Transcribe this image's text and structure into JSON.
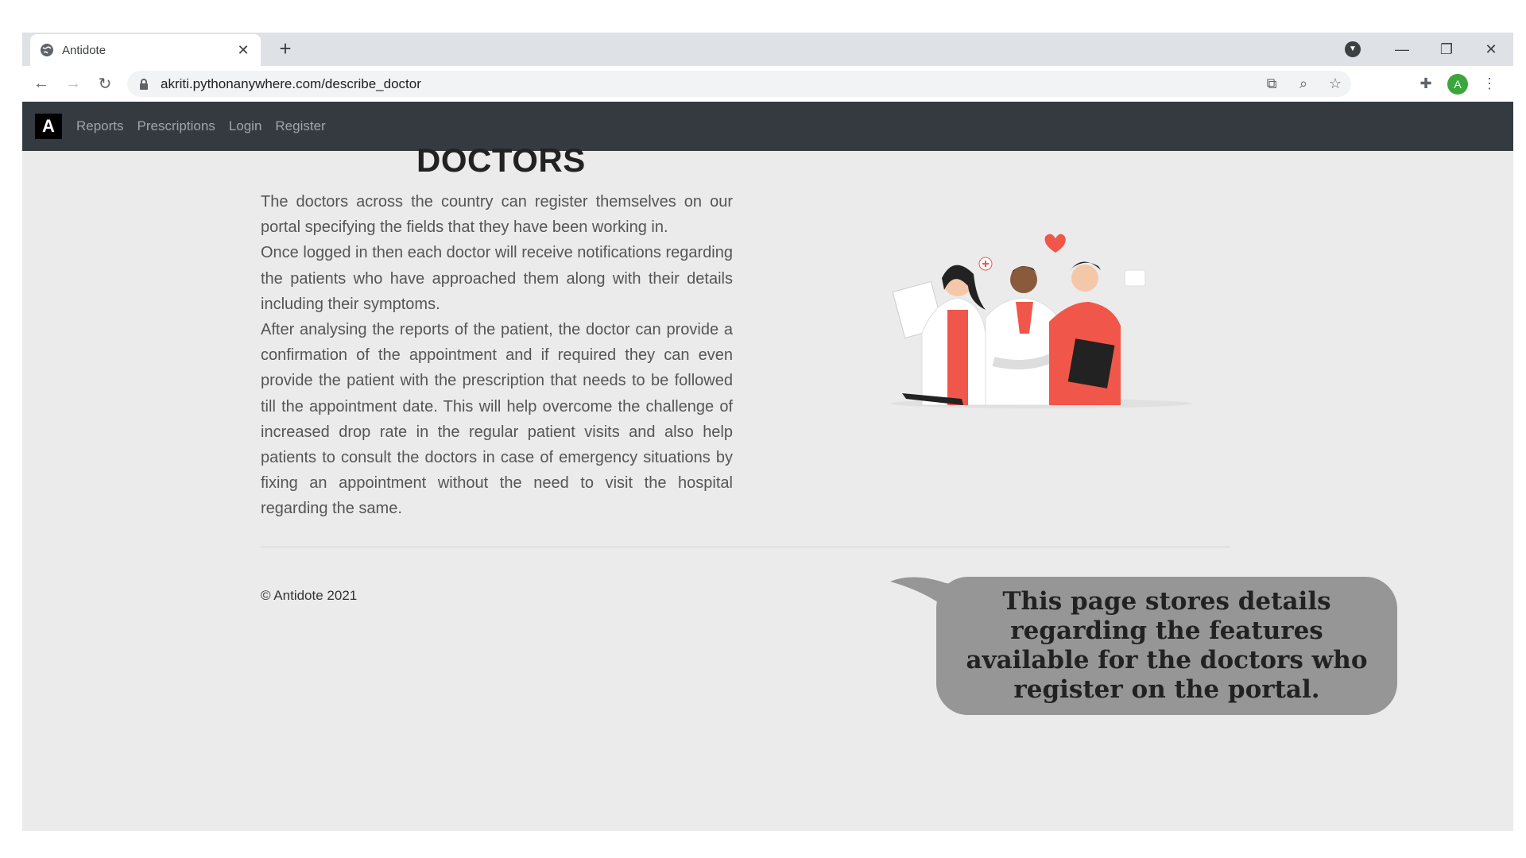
{
  "browser": {
    "tab_title": "Antidote",
    "url": "akriti.pythonanywhere.com/describe_doctor",
    "avatar_letter": "A"
  },
  "navbar": {
    "brand": "A",
    "links": [
      "Reports",
      "Prescriptions",
      "Login",
      "Register"
    ]
  },
  "main": {
    "title": "DOCTORS",
    "paragraphs": [
      "The doctors across the country can register themselves on our portal specifying the fields that they have been working in.",
      "Once logged in then each doctor will receive notifications regarding the patients who have approached them along with their details including their symptoms.",
      "After analysing the reports of the patient, the doctor can provide a confirmation of the appointment and if required they can even provide the patient with the prescription that needs to be followed till the appointment date. This will help overcome the challenge of increased drop rate in the regular patient visits and also help patients to consult the doctors in case of emergency situations by fixing an appointment without the need to visit the hospital regarding the same."
    ]
  },
  "footer": {
    "copyright": "© Antidote 2021"
  },
  "callout": {
    "text": "This page stores details regarding the features available for the doctors who register on the portal."
  },
  "colors": {
    "navbar_bg": "#343a40",
    "page_bg": "#ebebeb",
    "accent_red": "#f0574a",
    "callout_bg": "#969696"
  },
  "icons": [
    "globe-icon",
    "close-icon",
    "plus-icon",
    "back-icon",
    "forward-icon",
    "reload-icon",
    "lock-icon",
    "translate-icon",
    "zoom-icon",
    "star-icon",
    "puzzle-icon",
    "menu-icon"
  ]
}
